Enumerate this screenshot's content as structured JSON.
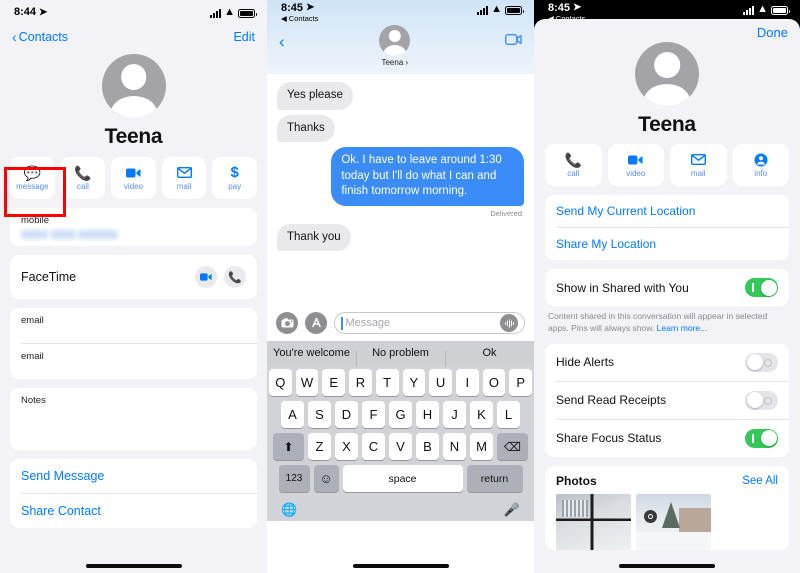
{
  "colors": {
    "accent_blue": "#007aff",
    "bubble_out": "#3b8cf7",
    "bubble_in": "#e9e9eb",
    "toggle_on": "#34c759",
    "toggle_off": "#e4e4e9",
    "highlight_red": "#ff0000",
    "page_bg": "#f2f2f7"
  },
  "panel1": {
    "status": {
      "time": "8:44",
      "location_icon": "location-arrow",
      "signal": "signal-bars",
      "wifi": "wifi",
      "battery": "battery-full"
    },
    "nav": {
      "back_label": "Contacts",
      "back_icon": "chevron-left-icon",
      "edit_label": "Edit"
    },
    "contact": {
      "name": "Teena",
      "avatar": "person-placeholder-avatar"
    },
    "actions": [
      {
        "icon": "message-bubble-icon",
        "label": "message",
        "highlighted": true
      },
      {
        "icon": "phone-icon",
        "label": "call"
      },
      {
        "icon": "video-camera-icon",
        "label": "video"
      },
      {
        "icon": "envelope-icon",
        "label": "mail"
      },
      {
        "icon": "dollar-sign-icon",
        "label": "pay"
      }
    ],
    "phone_card": {
      "label": "mobile",
      "value_redacted": true
    },
    "facetime": {
      "title": "FaceTime",
      "buttons": [
        "video-camera-icon",
        "phone-icon"
      ]
    },
    "email_rows": [
      "email",
      "email"
    ],
    "notes": {
      "label": "Notes"
    },
    "links": [
      "Send Message",
      "Share Contact"
    ]
  },
  "panel2": {
    "status": {
      "time": "8:45",
      "back_app": "Contacts",
      "location_icon": "location-arrow",
      "signal": "signal-bars",
      "wifi": "wifi",
      "battery": "battery-full"
    },
    "header": {
      "back_icon": "chevron-left-icon",
      "name": "Teena",
      "name_chevron": "›",
      "facetime_icon": "video-camera-icon",
      "highlighted": true
    },
    "messages": [
      {
        "side": "in",
        "text": "Yes please"
      },
      {
        "side": "in",
        "text": "Thanks"
      },
      {
        "side": "out",
        "text": "Ok. I have to leave around 1:30 today but I'll do what I can and finish tomorrow morning.",
        "status": "Delivered"
      },
      {
        "side": "in",
        "text": "Thank you"
      }
    ],
    "input": {
      "camera_icon": "camera-icon",
      "apps_icon": "app-store-icon",
      "placeholder": "Message",
      "value": "",
      "audio_icon": "audio-waveform-icon"
    },
    "predictions": [
      "You're welcome",
      "No problem",
      "Ok"
    ],
    "keyboard": {
      "row1": [
        "Q",
        "W",
        "E",
        "R",
        "T",
        "Y",
        "U",
        "I",
        "O",
        "P"
      ],
      "row2": [
        "A",
        "S",
        "D",
        "F",
        "G",
        "H",
        "J",
        "K",
        "L"
      ],
      "row3": [
        "Z",
        "X",
        "C",
        "V",
        "B",
        "N",
        "M"
      ],
      "shift": "⬆",
      "backspace": "⌫",
      "numbers": "123",
      "emoji": "☺",
      "space": "space",
      "return": "return",
      "globe": "globe-icon",
      "dictation": "microphone-icon"
    }
  },
  "panel3": {
    "status": {
      "time": "8:45",
      "back_app": "Contacts",
      "location_icon": "location-arrow",
      "signal": "signal-bars",
      "wifi": "wifi",
      "battery": "battery-full"
    },
    "done_label": "Done",
    "contact": {
      "name": "Teena",
      "avatar": "person-placeholder-avatar"
    },
    "actions": [
      {
        "icon": "phone-icon",
        "label": "call"
      },
      {
        "icon": "video-camera-icon",
        "label": "video"
      },
      {
        "icon": "envelope-icon",
        "label": "mail"
      },
      {
        "icon": "person-circle-icon",
        "label": "info"
      }
    ],
    "location_links": [
      "Send My Current Location",
      "Share My Location"
    ],
    "shared_with_you": {
      "label": "Show in Shared with You",
      "state": "on"
    },
    "footnote": {
      "text": "Content shared in this conversation will appear in selected apps. Pins will always show. ",
      "link": "Learn more..."
    },
    "toggles": [
      {
        "label": "Hide Alerts",
        "state": "off"
      },
      {
        "label": "Send Read Receipts",
        "state": "off",
        "highlighted": true
      },
      {
        "label": "Share Focus Status",
        "state": "on"
      }
    ],
    "photos": {
      "title": "Photos",
      "see_all": "See All",
      "items": [
        "snowy-patio-photo",
        "snowy-yard-photo"
      ]
    }
  }
}
